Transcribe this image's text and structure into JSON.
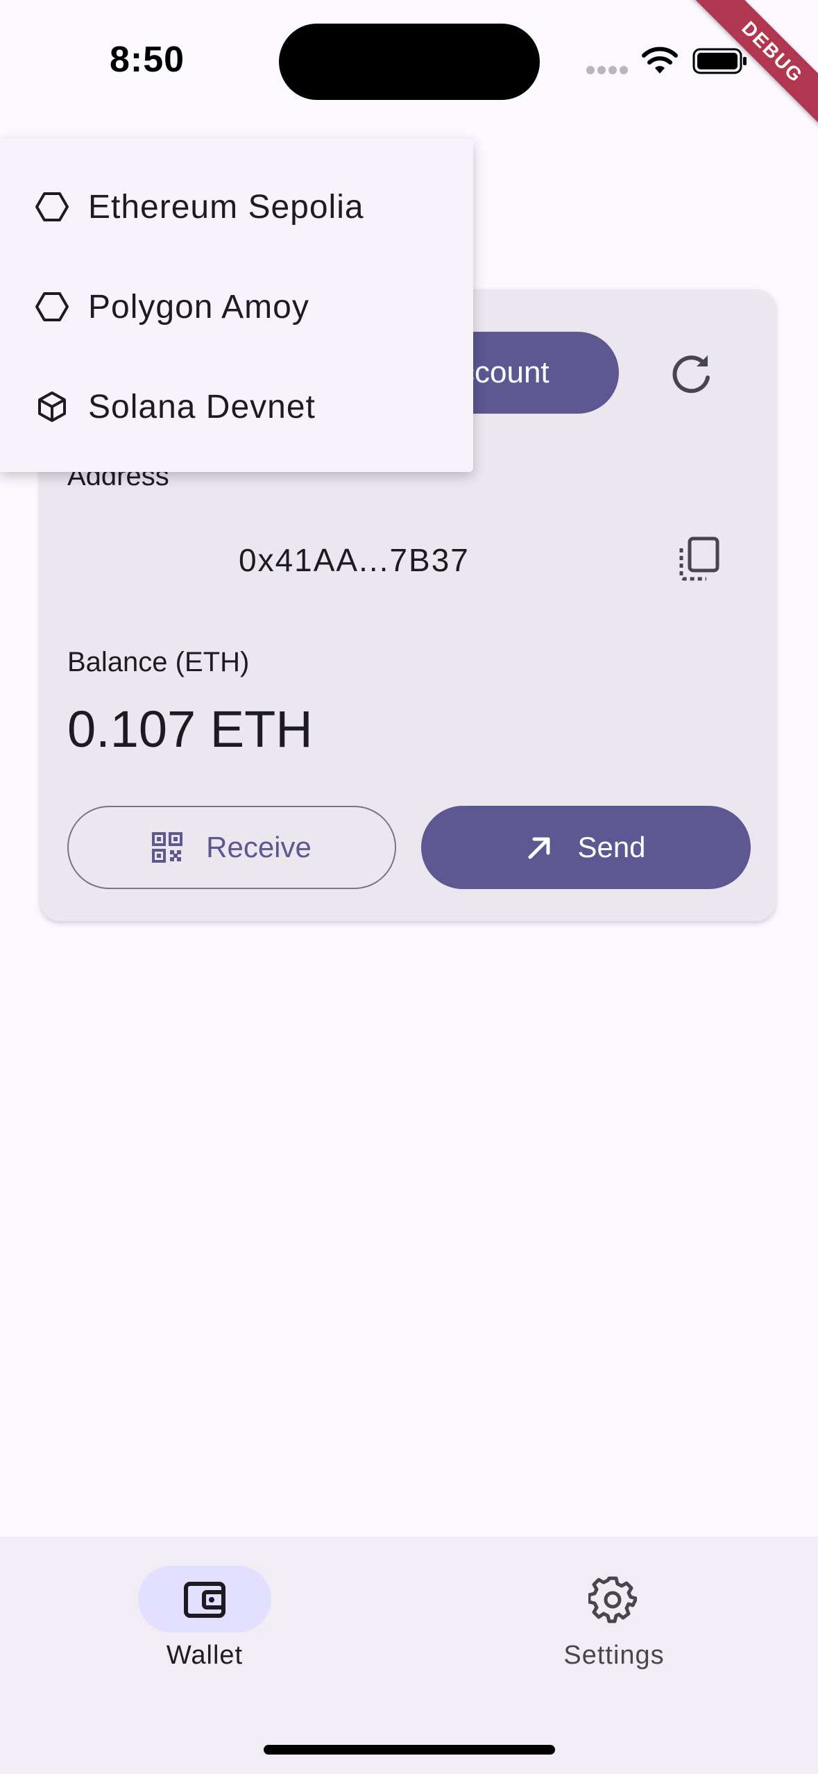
{
  "status_bar": {
    "time": "8:50"
  },
  "debug_banner": {
    "label": "DEBUG"
  },
  "network_menu": {
    "items": [
      {
        "label": "Ethereum Sepolia",
        "icon": "hexagon-outline-icon"
      },
      {
        "label": "Polygon Amoy",
        "icon": "hexagon-outline-icon"
      },
      {
        "label": "Solana Devnet",
        "icon": "cube-outline-icon"
      }
    ]
  },
  "wallet_card": {
    "account_button_label": "ccount",
    "address_label": "Address",
    "address_value": "0x41AA...7B37",
    "balance_label": "Balance (ETH)",
    "balance_value": "0.107 ETH",
    "receive_label": "Receive",
    "send_label": "Send"
  },
  "bottom_nav": {
    "items": [
      {
        "label": "Wallet",
        "icon": "wallet-icon",
        "selected": true
      },
      {
        "label": "Settings",
        "icon": "gear-icon",
        "selected": false
      }
    ]
  },
  "colors": {
    "primary": "#5d5792",
    "card_background": "#ece6ef",
    "page_background": "#fcf8ff",
    "debug_banner": "#b0374f"
  }
}
